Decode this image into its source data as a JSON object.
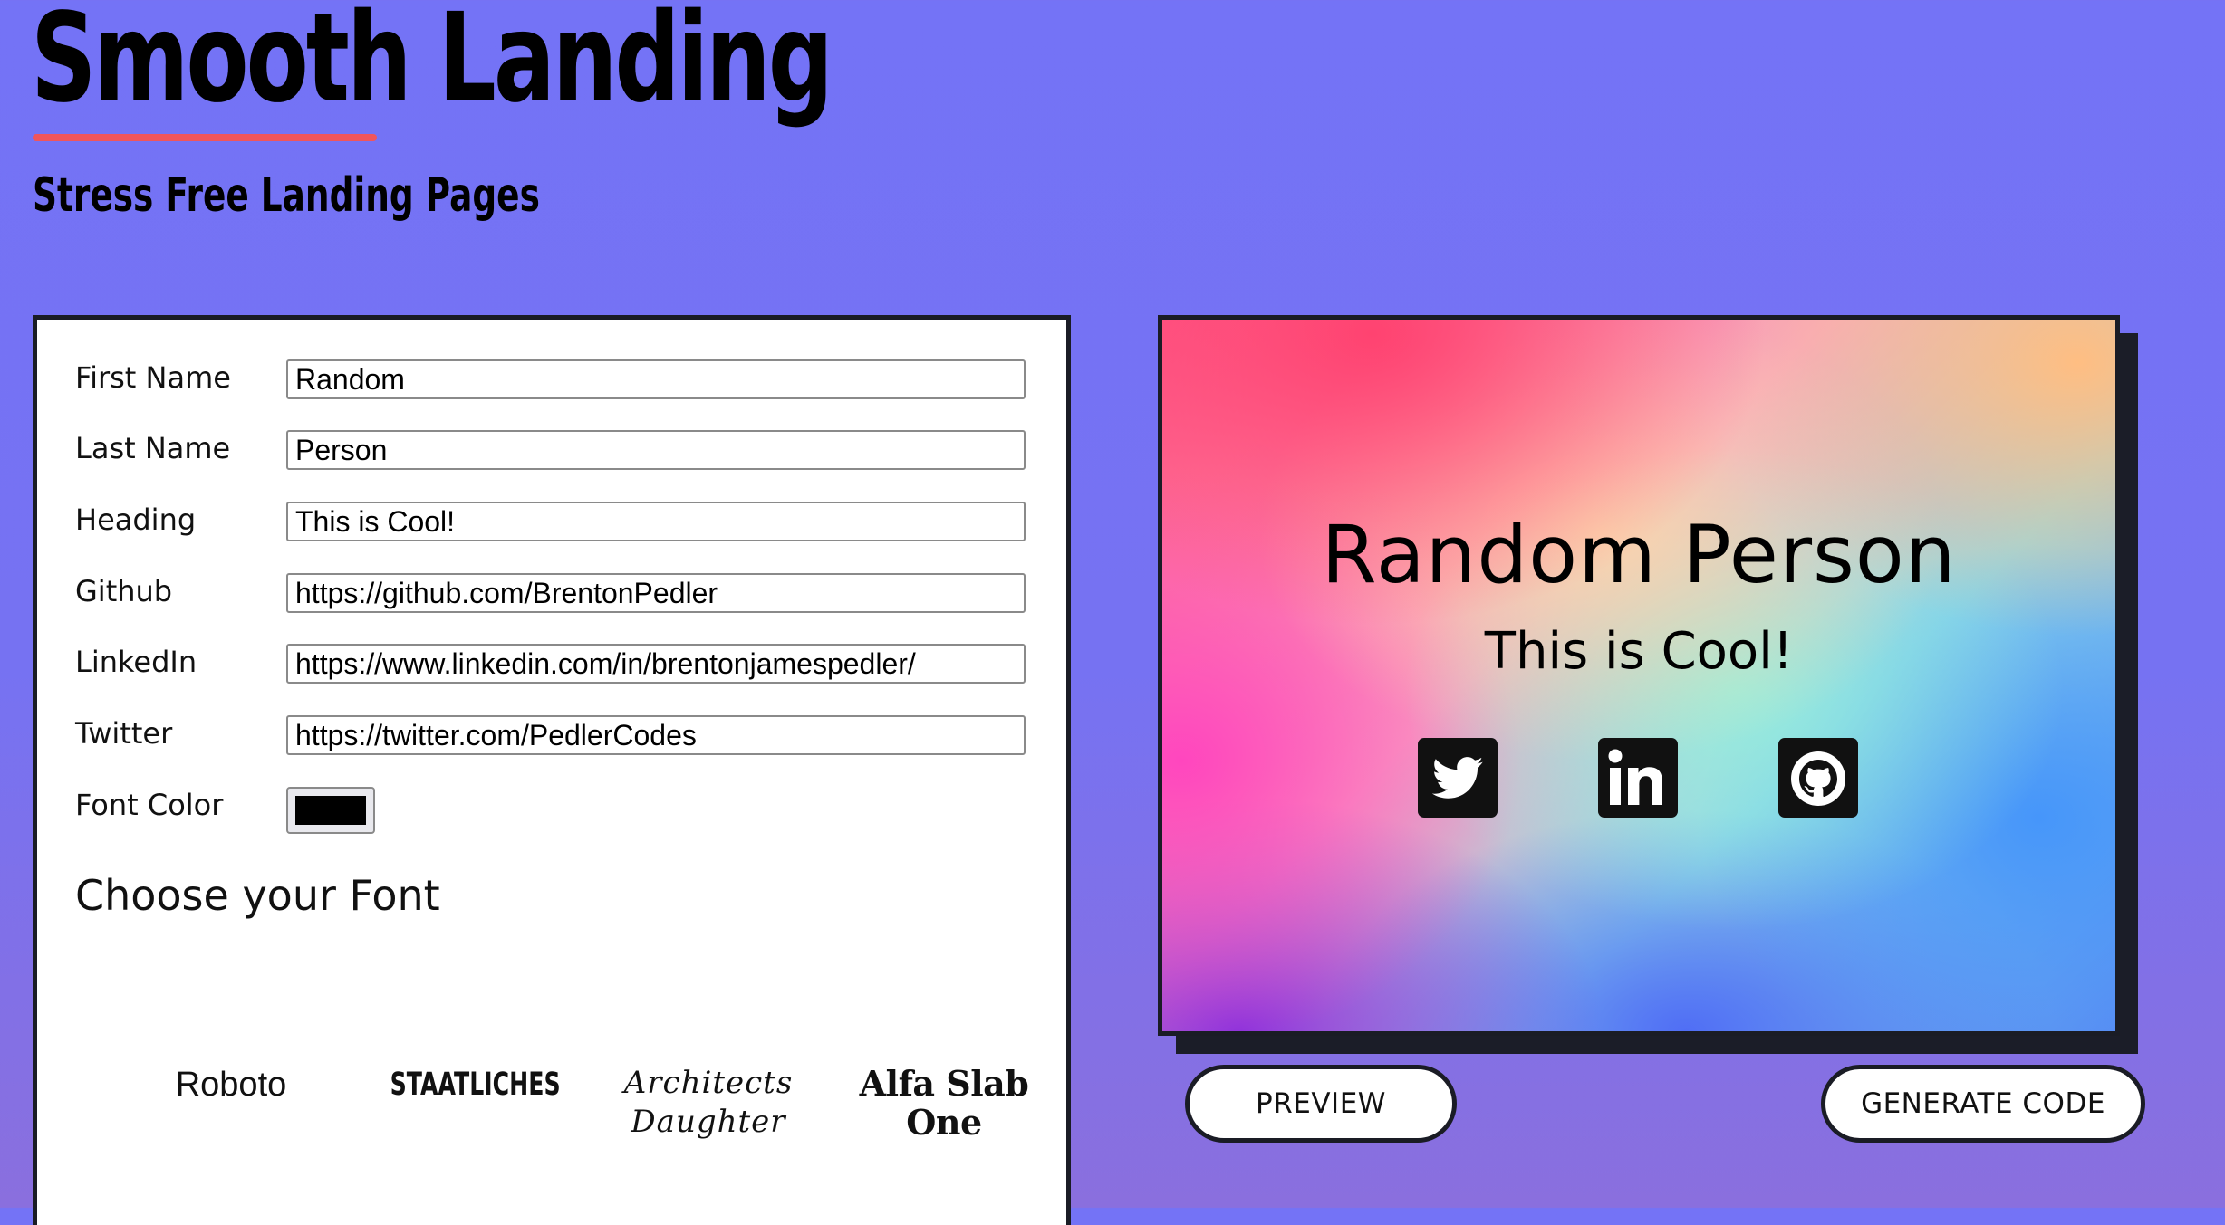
{
  "header": {
    "title": "Smooth Landing",
    "tagline": "Stress Free Landing Pages",
    "underline_color": "#f0555b"
  },
  "form": {
    "fields": [
      {
        "label": "First Name",
        "value": "Random"
      },
      {
        "label": "Last Name",
        "value": "Person"
      },
      {
        "label": "Heading",
        "value": "This is Cool!"
      },
      {
        "label": "Github",
        "value": "https://github.com/BrentonPedler"
      },
      {
        "label": "LinkedIn",
        "value": "https://www.linkedin.com/in/brentonjamespedler/"
      },
      {
        "label": "Twitter",
        "value": "https://twitter.com/PedlerCodes"
      }
    ],
    "font_color": {
      "label": "Font Color",
      "value": "#000000"
    },
    "font_section": {
      "heading": "Choose your Font",
      "options": [
        "Roboto",
        "STAATLICHES",
        "Architects Daughter",
        "Alfa Slab One"
      ]
    }
  },
  "preview": {
    "name": "Random Person",
    "heading": "This is Cool!",
    "icons": [
      "twitter-icon",
      "linkedin-icon",
      "github-icon"
    ]
  },
  "actions": {
    "preview_label": "PREVIEW",
    "generate_label": "GENERATE CODE"
  },
  "colors": {
    "background": "#7473f6",
    "panel_border": "#1a1c25",
    "accent": "#f0555b"
  }
}
